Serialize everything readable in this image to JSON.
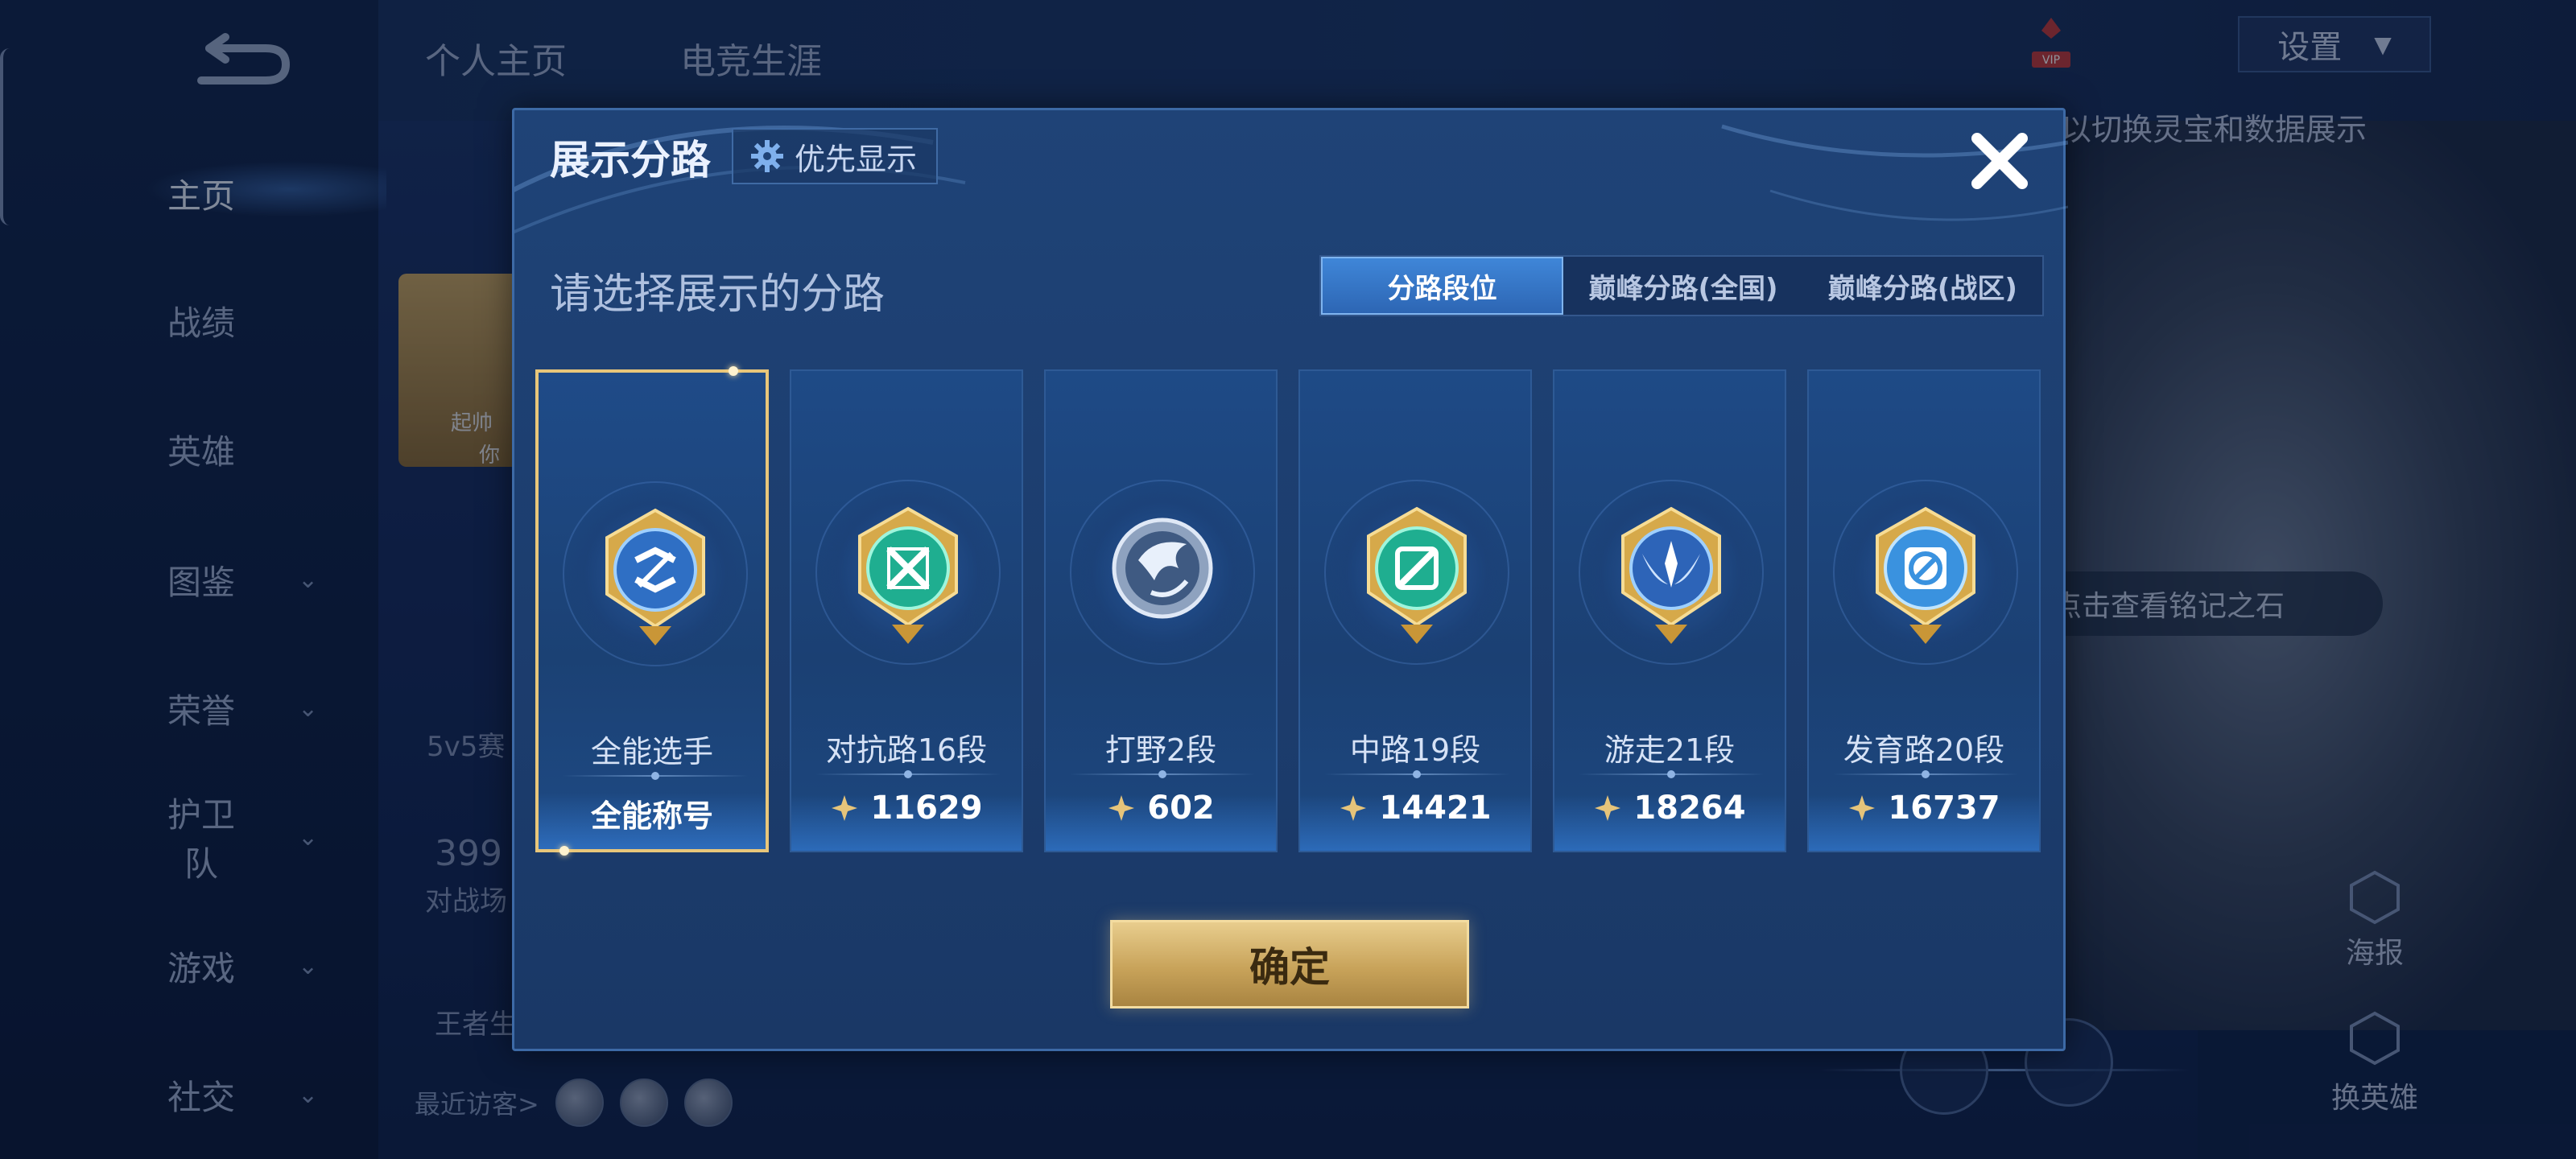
{
  "background": {
    "nav": [
      {
        "label": "主页",
        "active": true,
        "has_chevron": false
      },
      {
        "label": "战绩",
        "active": false,
        "has_chevron": false
      },
      {
        "label": "英雄",
        "active": false,
        "has_chevron": false
      },
      {
        "label": "图鉴",
        "active": false,
        "has_chevron": true
      },
      {
        "label": "荣誉",
        "active": false,
        "has_chevron": true
      },
      {
        "label": "护卫队",
        "active": false,
        "has_chevron": true
      },
      {
        "label": "游戏",
        "active": false,
        "has_chevron": true
      },
      {
        "label": "社交",
        "active": false,
        "has_chevron": true
      }
    ],
    "top_tabs": [
      "个人主页",
      "电竞生涯"
    ],
    "settings_label": "设置",
    "vip_label": "VIP",
    "hint_text": "以切换灵宝和数据展示",
    "mode_text": "5v5赛",
    "count_text": "399",
    "battle_text": "对战场",
    "glory_text": "王者生",
    "visitors_label": "最近访客>",
    "stone_pill": "点击查看铭记之石",
    "poster_label": "海报",
    "change_hero_label": "换英雄",
    "avatar_caption_1": "起帅",
    "avatar_caption_2": "你"
  },
  "modal": {
    "title": "展示分路",
    "priority_label": "优先显示",
    "subtitle": "请选择展示的分路",
    "tabs": [
      {
        "label": "分路段位",
        "active": true
      },
      {
        "label": "巅峰分路(全国)",
        "active": false
      },
      {
        "label": "巅峰分路(战区)",
        "active": false
      }
    ],
    "cards": [
      {
        "rank": "全能选手",
        "value": "全能称号",
        "has_star": false,
        "selected": true,
        "emblem": "all-round-emblem",
        "accent": "#3a7fd6"
      },
      {
        "rank": "对抗路16段",
        "value": "11629",
        "has_star": true,
        "selected": false,
        "emblem": "clash-lane-emblem",
        "accent": "#29c9a5"
      },
      {
        "rank": "打野2段",
        "value": "602",
        "has_star": true,
        "selected": false,
        "emblem": "jungle-emblem",
        "accent": "#9fb2cc"
      },
      {
        "rank": "中路19段",
        "value": "14421",
        "has_star": true,
        "selected": false,
        "emblem": "mid-lane-emblem",
        "accent": "#29c9a5"
      },
      {
        "rank": "游走21段",
        "value": "18264",
        "has_star": true,
        "selected": false,
        "emblem": "roam-emblem",
        "accent": "#3a7fd6"
      },
      {
        "rank": "发育路20段",
        "value": "16737",
        "has_star": true,
        "selected": false,
        "emblem": "farm-lane-emblem",
        "accent": "#4aa7ef"
      }
    ],
    "confirm_label": "确定"
  }
}
